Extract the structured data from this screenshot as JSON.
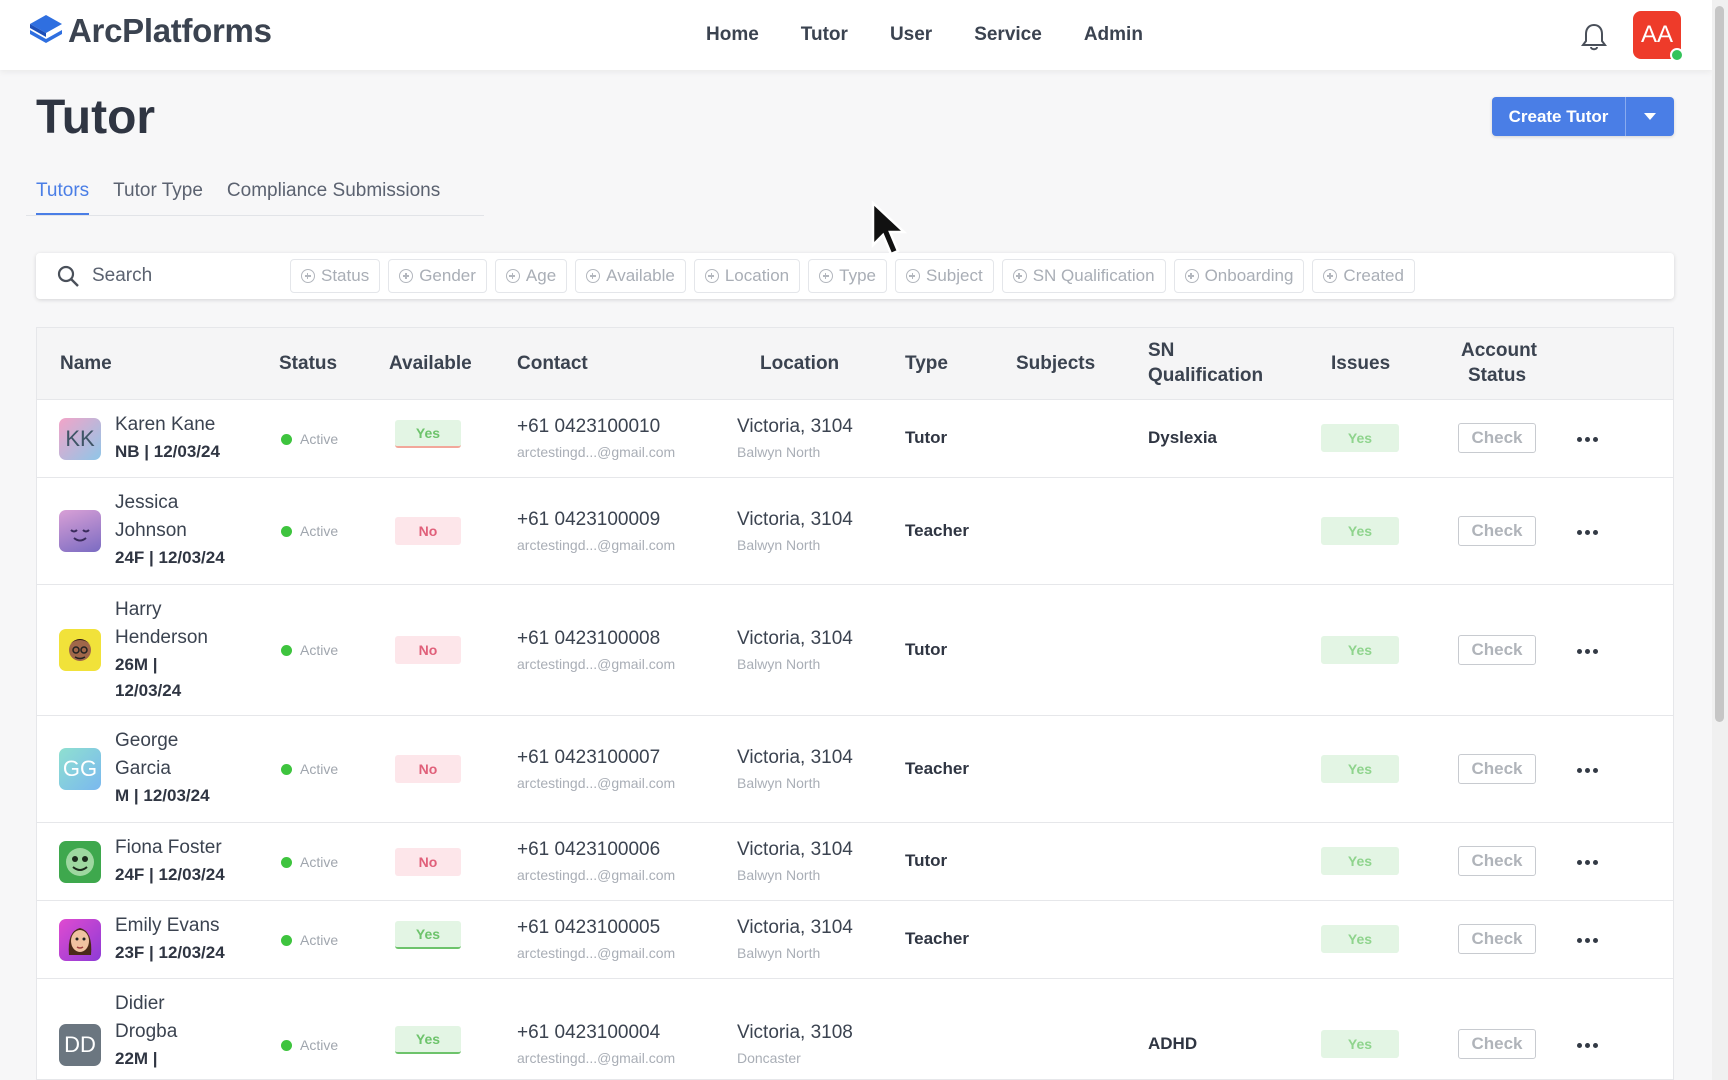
{
  "app": {
    "brand": "ArcPlatforms",
    "avatar_initials": "AA"
  },
  "nav": [
    "Home",
    "Tutor",
    "User",
    "Service",
    "Admin"
  ],
  "page": {
    "title": "Tutor",
    "create_label": "Create Tutor"
  },
  "tabs": [
    "Tutors",
    "Tutor Type",
    "Compliance Submissions"
  ],
  "search": {
    "placeholder": "Search"
  },
  "filters": [
    "Status",
    "Gender",
    "Age",
    "Available",
    "Location",
    "Type",
    "Subject",
    "SN Qualification",
    "Onboarding",
    "Created"
  ],
  "columns": {
    "name": "Name",
    "status": "Status",
    "available": "Available",
    "contact": "Contact",
    "location": "Location",
    "type": "Type",
    "subjects": "Subjects",
    "snq1": "SN",
    "snq2": "Qualification",
    "issues": "Issues",
    "acc1": "Account",
    "acc2": "Status"
  },
  "rows": [
    {
      "initials": "KK",
      "name1": "Karen Kane",
      "name2": "",
      "meta1": "NB | 12/03/24",
      "meta2": "",
      "status": "Active",
      "available": "Yes",
      "phone": "+61 0423100010",
      "email": "arctestingd...@gmail.com",
      "location": "Victoria, 3104",
      "suburb": "Balwyn North",
      "type": "Tutor",
      "sn": "Dyslexia",
      "issues": "Yes",
      "check": "Check"
    },
    {
      "initials": "",
      "name1": "Jessica",
      "name2": "Johnson",
      "meta1": "24F | 12/03/24",
      "meta2": "",
      "status": "Active",
      "available": "No",
      "phone": "+61 0423100009",
      "email": "arctestingd...@gmail.com",
      "location": "Victoria, 3104",
      "suburb": "Balwyn North",
      "type": "Teacher",
      "sn": "",
      "issues": "Yes",
      "check": "Check"
    },
    {
      "initials": "",
      "name1": "Harry",
      "name2": "Henderson",
      "meta1": "26M |",
      "meta2": "12/03/24",
      "status": "Active",
      "available": "No",
      "phone": "+61 0423100008",
      "email": "arctestingd...@gmail.com",
      "location": "Victoria, 3104",
      "suburb": "Balwyn North",
      "type": "Tutor",
      "sn": "",
      "issues": "Yes",
      "check": "Check"
    },
    {
      "initials": "GG",
      "name1": "George",
      "name2": "Garcia",
      "meta1": "M | 12/03/24",
      "meta2": "",
      "status": "Active",
      "available": "No",
      "phone": "+61 0423100007",
      "email": "arctestingd...@gmail.com",
      "location": "Victoria, 3104",
      "suburb": "Balwyn North",
      "type": "Teacher",
      "sn": "",
      "issues": "Yes",
      "check": "Check"
    },
    {
      "initials": "",
      "name1": "Fiona Foster",
      "name2": "",
      "meta1": "24F | 12/03/24",
      "meta2": "",
      "status": "Active",
      "available": "No",
      "phone": "+61 0423100006",
      "email": "arctestingd...@gmail.com",
      "location": "Victoria, 3104",
      "suburb": "Balwyn North",
      "type": "Tutor",
      "sn": "",
      "issues": "Yes",
      "check": "Check"
    },
    {
      "initials": "",
      "name1": "Emily Evans",
      "name2": "",
      "meta1": "23F | 12/03/24",
      "meta2": "",
      "status": "Active",
      "available": "Yes",
      "phone": "+61 0423100005",
      "email": "arctestingd...@gmail.com",
      "location": "Victoria, 3104",
      "suburb": "Balwyn North",
      "type": "Teacher",
      "sn": "",
      "issues": "Yes",
      "check": "Check"
    },
    {
      "initials": "DD",
      "name1": "Didier",
      "name2": "Drogba",
      "meta1": "22M |",
      "meta2": "",
      "status": "Active",
      "available": "Yes",
      "phone": "+61 0423100004",
      "email": "arctestingd...@gmail.com",
      "location": "Victoria, 3108",
      "suburb": "Doncaster",
      "type": "",
      "sn": "ADHD",
      "issues": "Yes",
      "check": "Check"
    }
  ],
  "icons": {
    "bell": "bell-icon",
    "search": "search-icon",
    "caret": "chevron-down-icon",
    "more": "more-horizontal-icon"
  },
  "colors": {
    "accent": "#4a7ee6",
    "avatar_bg": "#ee3b2a",
    "active_dot": "#3ec43e"
  }
}
